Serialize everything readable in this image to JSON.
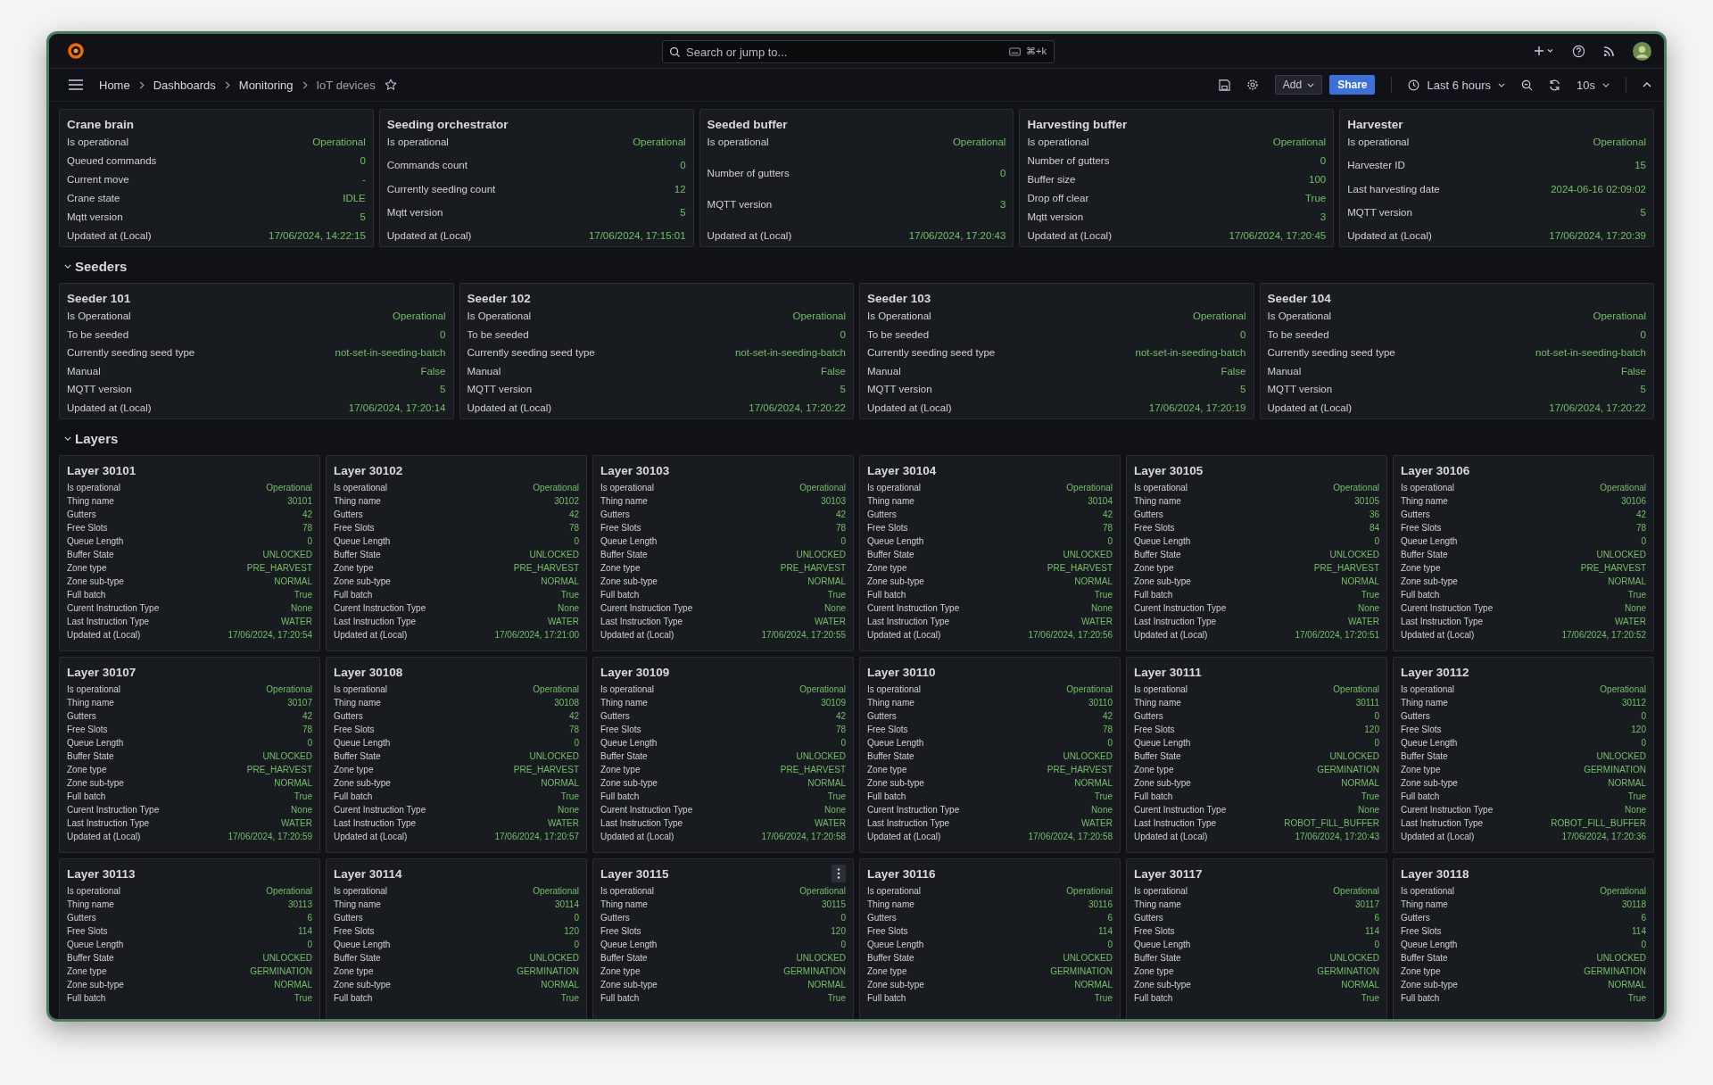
{
  "topbar": {
    "search_placeholder": "Search or jump to...",
    "search_shortcut": "⌘+k"
  },
  "breadcrumbs": [
    {
      "label": "Home"
    },
    {
      "label": "Dashboards"
    },
    {
      "label": "Monitoring"
    },
    {
      "label": "IoT devices"
    }
  ],
  "toolbar": {
    "add": "Add",
    "share": "Share",
    "time_range": "Last 6 hours",
    "refresh": "10s"
  },
  "sections": [
    {
      "panels": [
        {
          "title": "Crane brain",
          "rows": [
            {
              "label": "Is operational",
              "value": "Operational"
            },
            {
              "label": "Queued commands",
              "value": "0"
            },
            {
              "label": "Current move",
              "value": "-"
            },
            {
              "label": "Crane state",
              "value": "IDLE"
            },
            {
              "label": "Mqtt version",
              "value": "5"
            },
            {
              "label": "Updated at (Local)",
              "value": "17/06/2024, 14:22:15"
            }
          ]
        },
        {
          "title": "Seeding orchestrator",
          "rows": [
            {
              "label": "Is operational",
              "value": "Operational"
            },
            {
              "label": "Commands count",
              "value": "0"
            },
            {
              "label": "Currently seeding count",
              "value": "12"
            },
            {
              "label": "Mqtt version",
              "value": "5"
            },
            {
              "label": "Updated at (Local)",
              "value": "17/06/2024, 17:15:01"
            }
          ]
        },
        {
          "title": "Seeded buffer",
          "rows": [
            {
              "label": "Is operational",
              "value": "Operational"
            },
            {
              "label": "Number of gutters",
              "value": "0"
            },
            {
              "label": "MQTT version",
              "value": "3"
            },
            {
              "label": "Updated at (Local)",
              "value": "17/06/2024, 17:20:43"
            }
          ]
        },
        {
          "title": "Harvesting buffer",
          "rows": [
            {
              "label": "Is operational",
              "value": "Operational"
            },
            {
              "label": "Number of gutters",
              "value": "0"
            },
            {
              "label": "Buffer size",
              "value": "100"
            },
            {
              "label": "Drop off clear",
              "value": "True"
            },
            {
              "label": "Mqtt version",
              "value": "3"
            },
            {
              "label": "Updated at (Local)",
              "value": "17/06/2024, 17:20:45"
            }
          ]
        },
        {
          "title": "Harvester",
          "rows": [
            {
              "label": "Is operational",
              "value": "Operational"
            },
            {
              "label": "Harvester ID",
              "value": "15"
            },
            {
              "label": "Last harvesting date",
              "value": "2024-06-16 02:09:02"
            },
            {
              "label": "MQTT version",
              "value": "5"
            },
            {
              "label": "Updated at (Local)",
              "value": "17/06/2024, 17:20:39"
            }
          ]
        }
      ]
    },
    {
      "title": "Seeders",
      "expanded": true,
      "panels": [
        {
          "title": "Seeder 101",
          "rows": [
            {
              "label": "Is Operational",
              "value": "Operational"
            },
            {
              "label": "To be seeded",
              "value": "0"
            },
            {
              "label": "Currently seeding seed type",
              "value": "not-set-in-seeding-batch"
            },
            {
              "label": "Manual",
              "value": "False"
            },
            {
              "label": "MQTT version",
              "value": "5"
            },
            {
              "label": "Updated at (Local)",
              "value": "17/06/2024, 17:20:14"
            }
          ]
        },
        {
          "title": "Seeder 102",
          "rows": [
            {
              "label": "Is Operational",
              "value": "Operational"
            },
            {
              "label": "To be seeded",
              "value": "0"
            },
            {
              "label": "Currently seeding seed type",
              "value": "not-set-in-seeding-batch"
            },
            {
              "label": "Manual",
              "value": "False"
            },
            {
              "label": "MQTT version",
              "value": "5"
            },
            {
              "label": "Updated at (Local)",
              "value": "17/06/2024, 17:20:22"
            }
          ]
        },
        {
          "title": "Seeder 103",
          "rows": [
            {
              "label": "Is Operational",
              "value": "Operational"
            },
            {
              "label": "To be seeded",
              "value": "0"
            },
            {
              "label": "Currently seeding seed type",
              "value": "not-set-in-seeding-batch"
            },
            {
              "label": "Manual",
              "value": "False"
            },
            {
              "label": "MQTT version",
              "value": "5"
            },
            {
              "label": "Updated at (Local)",
              "value": "17/06/2024, 17:20:19"
            }
          ]
        },
        {
          "title": "Seeder 104",
          "rows": [
            {
              "label": "Is Operational",
              "value": "Operational"
            },
            {
              "label": "To be seeded",
              "value": "0"
            },
            {
              "label": "Currently seeding seed type",
              "value": "not-set-in-seeding-batch"
            },
            {
              "label": "Manual",
              "value": "False"
            },
            {
              "label": "MQTT version",
              "value": "5"
            },
            {
              "label": "Updated at (Local)",
              "value": "17/06/2024, 17:20:22"
            }
          ]
        }
      ]
    },
    {
      "title": "Layers",
      "expanded": true,
      "panels": [
        {
          "title": "Layer 30101",
          "rows": [
            {
              "label": "Is operational",
              "value": "Operational"
            },
            {
              "label": "Thing name",
              "value": "30101"
            },
            {
              "label": "Gutters",
              "value": "42"
            },
            {
              "label": "Free Slots",
              "value": "78"
            },
            {
              "label": "Queue Length",
              "value": "0"
            },
            {
              "label": "Buffer State",
              "value": "UNLOCKED"
            },
            {
              "label": "Zone type",
              "value": "PRE_HARVEST"
            },
            {
              "label": "Zone sub-type",
              "value": "NORMAL"
            },
            {
              "label": "Full batch",
              "value": "True"
            },
            {
              "label": "Curent Instruction Type",
              "value": "None"
            },
            {
              "label": "Last Instruction Type",
              "value": "WATER"
            },
            {
              "label": "Updated at (Local)",
              "value": "17/06/2024, 17:20:54"
            }
          ]
        },
        {
          "title": "Layer 30102",
          "rows": [
            {
              "label": "Is operational",
              "value": "Operational"
            },
            {
              "label": "Thing name",
              "value": "30102"
            },
            {
              "label": "Gutters",
              "value": "42"
            },
            {
              "label": "Free Slots",
              "value": "78"
            },
            {
              "label": "Queue Length",
              "value": "0"
            },
            {
              "label": "Buffer State",
              "value": "UNLOCKED"
            },
            {
              "label": "Zone type",
              "value": "PRE_HARVEST"
            },
            {
              "label": "Zone sub-type",
              "value": "NORMAL"
            },
            {
              "label": "Full batch",
              "value": "True"
            },
            {
              "label": "Curent Instruction Type",
              "value": "None"
            },
            {
              "label": "Last Instruction Type",
              "value": "WATER"
            },
            {
              "label": "Updated at (Local)",
              "value": "17/06/2024, 17:21:00"
            }
          ]
        },
        {
          "title": "Layer 30103",
          "rows": [
            {
              "label": "Is operational",
              "value": "Operational"
            },
            {
              "label": "Thing name",
              "value": "30103"
            },
            {
              "label": "Gutters",
              "value": "42"
            },
            {
              "label": "Free Slots",
              "value": "78"
            },
            {
              "label": "Queue Length",
              "value": "0"
            },
            {
              "label": "Buffer State",
              "value": "UNLOCKED"
            },
            {
              "label": "Zone type",
              "value": "PRE_HARVEST"
            },
            {
              "label": "Zone sub-type",
              "value": "NORMAL"
            },
            {
              "label": "Full batch",
              "value": "True"
            },
            {
              "label": "Curent Instruction Type",
              "value": "None"
            },
            {
              "label": "Last Instruction Type",
              "value": "WATER"
            },
            {
              "label": "Updated at (Local)",
              "value": "17/06/2024, 17:20:55"
            }
          ]
        },
        {
          "title": "Layer 30104",
          "rows": [
            {
              "label": "Is operational",
              "value": "Operational"
            },
            {
              "label": "Thing name",
              "value": "30104"
            },
            {
              "label": "Gutters",
              "value": "42"
            },
            {
              "label": "Free Slots",
              "value": "78"
            },
            {
              "label": "Queue Length",
              "value": "0"
            },
            {
              "label": "Buffer State",
              "value": "UNLOCKED"
            },
            {
              "label": "Zone type",
              "value": "PRE_HARVEST"
            },
            {
              "label": "Zone sub-type",
              "value": "NORMAL"
            },
            {
              "label": "Full batch",
              "value": "True"
            },
            {
              "label": "Curent Instruction Type",
              "value": "None"
            },
            {
              "label": "Last Instruction Type",
              "value": "WATER"
            },
            {
              "label": "Updated at (Local)",
              "value": "17/06/2024, 17:20:56"
            }
          ]
        },
        {
          "title": "Layer 30105",
          "rows": [
            {
              "label": "Is operational",
              "value": "Operational"
            },
            {
              "label": "Thing name",
              "value": "30105"
            },
            {
              "label": "Gutters",
              "value": "36"
            },
            {
              "label": "Free Slots",
              "value": "84"
            },
            {
              "label": "Queue Length",
              "value": "0"
            },
            {
              "label": "Buffer State",
              "value": "UNLOCKED"
            },
            {
              "label": "Zone type",
              "value": "PRE_HARVEST"
            },
            {
              "label": "Zone sub-type",
              "value": "NORMAL"
            },
            {
              "label": "Full batch",
              "value": "True"
            },
            {
              "label": "Curent Instruction Type",
              "value": "None"
            },
            {
              "label": "Last Instruction Type",
              "value": "WATER"
            },
            {
              "label": "Updated at (Local)",
              "value": "17/06/2024, 17:20:51"
            }
          ]
        },
        {
          "title": "Layer 30106",
          "rows": [
            {
              "label": "Is operational",
              "value": "Operational"
            },
            {
              "label": "Thing name",
              "value": "30106"
            },
            {
              "label": "Gutters",
              "value": "42"
            },
            {
              "label": "Free Slots",
              "value": "78"
            },
            {
              "label": "Queue Length",
              "value": "0"
            },
            {
              "label": "Buffer State",
              "value": "UNLOCKED"
            },
            {
              "label": "Zone type",
              "value": "PRE_HARVEST"
            },
            {
              "label": "Zone sub-type",
              "value": "NORMAL"
            },
            {
              "label": "Full batch",
              "value": "True"
            },
            {
              "label": "Curent Instruction Type",
              "value": "None"
            },
            {
              "label": "Last Instruction Type",
              "value": "WATER"
            },
            {
              "label": "Updated at (Local)",
              "value": "17/06/2024, 17:20:52"
            }
          ]
        },
        {
          "title": "Layer 30107",
          "rows": [
            {
              "label": "Is operational",
              "value": "Operational"
            },
            {
              "label": "Thing name",
              "value": "30107"
            },
            {
              "label": "Gutters",
              "value": "42"
            },
            {
              "label": "Free Slots",
              "value": "78"
            },
            {
              "label": "Queue Length",
              "value": "0"
            },
            {
              "label": "Buffer State",
              "value": "UNLOCKED"
            },
            {
              "label": "Zone type",
              "value": "PRE_HARVEST"
            },
            {
              "label": "Zone sub-type",
              "value": "NORMAL"
            },
            {
              "label": "Full batch",
              "value": "True"
            },
            {
              "label": "Curent Instruction Type",
              "value": "None"
            },
            {
              "label": "Last Instruction Type",
              "value": "WATER"
            },
            {
              "label": "Updated at (Local)",
              "value": "17/06/2024, 17:20:59"
            }
          ]
        },
        {
          "title": "Layer 30108",
          "rows": [
            {
              "label": "Is operational",
              "value": "Operational"
            },
            {
              "label": "Thing name",
              "value": "30108"
            },
            {
              "label": "Gutters",
              "value": "42"
            },
            {
              "label": "Free Slots",
              "value": "78"
            },
            {
              "label": "Queue Length",
              "value": "0"
            },
            {
              "label": "Buffer State",
              "value": "UNLOCKED"
            },
            {
              "label": "Zone type",
              "value": "PRE_HARVEST"
            },
            {
              "label": "Zone sub-type",
              "value": "NORMAL"
            },
            {
              "label": "Full batch",
              "value": "True"
            },
            {
              "label": "Curent Instruction Type",
              "value": "None"
            },
            {
              "label": "Last Instruction Type",
              "value": "WATER"
            },
            {
              "label": "Updated at (Local)",
              "value": "17/06/2024, 17:20:57"
            }
          ]
        },
        {
          "title": "Layer 30109",
          "rows": [
            {
              "label": "Is operational",
              "value": "Operational"
            },
            {
              "label": "Thing name",
              "value": "30109"
            },
            {
              "label": "Gutters",
              "value": "42"
            },
            {
              "label": "Free Slots",
              "value": "78"
            },
            {
              "label": "Queue Length",
              "value": "0"
            },
            {
              "label": "Buffer State",
              "value": "UNLOCKED"
            },
            {
              "label": "Zone type",
              "value": "PRE_HARVEST"
            },
            {
              "label": "Zone sub-type",
              "value": "NORMAL"
            },
            {
              "label": "Full batch",
              "value": "True"
            },
            {
              "label": "Curent Instruction Type",
              "value": "None"
            },
            {
              "label": "Last Instruction Type",
              "value": "WATER"
            },
            {
              "label": "Updated at (Local)",
              "value": "17/06/2024, 17:20:58"
            }
          ]
        },
        {
          "title": "Layer 30110",
          "rows": [
            {
              "label": "Is operational",
              "value": "Operational"
            },
            {
              "label": "Thing name",
              "value": "30110"
            },
            {
              "label": "Gutters",
              "value": "42"
            },
            {
              "label": "Free Slots",
              "value": "78"
            },
            {
              "label": "Queue Length",
              "value": "0"
            },
            {
              "label": "Buffer State",
              "value": "UNLOCKED"
            },
            {
              "label": "Zone type",
              "value": "PRE_HARVEST"
            },
            {
              "label": "Zone sub-type",
              "value": "NORMAL"
            },
            {
              "label": "Full batch",
              "value": "True"
            },
            {
              "label": "Curent Instruction Type",
              "value": "None"
            },
            {
              "label": "Last Instruction Type",
              "value": "WATER"
            },
            {
              "label": "Updated at (Local)",
              "value": "17/06/2024, 17:20:58"
            }
          ]
        },
        {
          "title": "Layer 30111",
          "rows": [
            {
              "label": "Is operational",
              "value": "Operational"
            },
            {
              "label": "Thing name",
              "value": "30111"
            },
            {
              "label": "Gutters",
              "value": "0"
            },
            {
              "label": "Free Slots",
              "value": "120"
            },
            {
              "label": "Queue Length",
              "value": "0"
            },
            {
              "label": "Buffer State",
              "value": "UNLOCKED"
            },
            {
              "label": "Zone type",
              "value": "GERMINATION"
            },
            {
              "label": "Zone sub-type",
              "value": "NORMAL"
            },
            {
              "label": "Full batch",
              "value": "True"
            },
            {
              "label": "Curent Instruction Type",
              "value": "None"
            },
            {
              "label": "Last Instruction Type",
              "value": "ROBOT_FILL_BUFFER"
            },
            {
              "label": "Updated at (Local)",
              "value": "17/06/2024, 17:20:43"
            }
          ]
        },
        {
          "title": "Layer 30112",
          "rows": [
            {
              "label": "Is operational",
              "value": "Operational"
            },
            {
              "label": "Thing name",
              "value": "30112"
            },
            {
              "label": "Gutters",
              "value": "0"
            },
            {
              "label": "Free Slots",
              "value": "120"
            },
            {
              "label": "Queue Length",
              "value": "0"
            },
            {
              "label": "Buffer State",
              "value": "UNLOCKED"
            },
            {
              "label": "Zone type",
              "value": "GERMINATION"
            },
            {
              "label": "Zone sub-type",
              "value": "NORMAL"
            },
            {
              "label": "Full batch",
              "value": "True"
            },
            {
              "label": "Curent Instruction Type",
              "value": "None"
            },
            {
              "label": "Last Instruction Type",
              "value": "ROBOT_FILL_BUFFER"
            },
            {
              "label": "Updated at (Local)",
              "value": "17/06/2024, 17:20:36"
            }
          ]
        },
        {
          "title": "Layer 30113",
          "rows": [
            {
              "label": "Is operational",
              "value": "Operational"
            },
            {
              "label": "Thing name",
              "value": "30113"
            },
            {
              "label": "Gutters",
              "value": "6"
            },
            {
              "label": "Free Slots",
              "value": "114"
            },
            {
              "label": "Queue Length",
              "value": "0"
            },
            {
              "label": "Buffer State",
              "value": "UNLOCKED"
            },
            {
              "label": "Zone type",
              "value": "GERMINATION"
            },
            {
              "label": "Zone sub-type",
              "value": "NORMAL"
            },
            {
              "label": "Full batch",
              "value": "True"
            }
          ]
        },
        {
          "title": "Layer 30114",
          "rows": [
            {
              "label": "Is operational",
              "value": "Operational"
            },
            {
              "label": "Thing name",
              "value": "30114"
            },
            {
              "label": "Gutters",
              "value": "0"
            },
            {
              "label": "Free Slots",
              "value": "120"
            },
            {
              "label": "Queue Length",
              "value": "0"
            },
            {
              "label": "Buffer State",
              "value": "UNLOCKED"
            },
            {
              "label": "Zone type",
              "value": "GERMINATION"
            },
            {
              "label": "Zone sub-type",
              "value": "NORMAL"
            },
            {
              "label": "Full batch",
              "value": "True"
            }
          ]
        },
        {
          "title": "Layer 30115",
          "menu_shown": true,
          "rows": [
            {
              "label": "Is operational",
              "value": "Operational"
            },
            {
              "label": "Thing name",
              "value": "30115"
            },
            {
              "label": "Gutters",
              "value": "0"
            },
            {
              "label": "Free Slots",
              "value": "120"
            },
            {
              "label": "Queue Length",
              "value": "0"
            },
            {
              "label": "Buffer State",
              "value": "UNLOCKED"
            },
            {
              "label": "Zone type",
              "value": "GERMINATION"
            },
            {
              "label": "Zone sub-type",
              "value": "NORMAL"
            },
            {
              "label": "Full batch",
              "value": "True"
            }
          ]
        },
        {
          "title": "Layer 30116",
          "rows": [
            {
              "label": "Is operational",
              "value": "Operational"
            },
            {
              "label": "Thing name",
              "value": "30116"
            },
            {
              "label": "Gutters",
              "value": "6"
            },
            {
              "label": "Free Slots",
              "value": "114"
            },
            {
              "label": "Queue Length",
              "value": "0"
            },
            {
              "label": "Buffer State",
              "value": "UNLOCKED"
            },
            {
              "label": "Zone type",
              "value": "GERMINATION"
            },
            {
              "label": "Zone sub-type",
              "value": "NORMAL"
            },
            {
              "label": "Full batch",
              "value": "True"
            }
          ]
        },
        {
          "title": "Layer 30117",
          "rows": [
            {
              "label": "Is operational",
              "value": "Operational"
            },
            {
              "label": "Thing name",
              "value": "30117"
            },
            {
              "label": "Gutters",
              "value": "6"
            },
            {
              "label": "Free Slots",
              "value": "114"
            },
            {
              "label": "Queue Length",
              "value": "0"
            },
            {
              "label": "Buffer State",
              "value": "UNLOCKED"
            },
            {
              "label": "Zone type",
              "value": "GERMINATION"
            },
            {
              "label": "Zone sub-type",
              "value": "NORMAL"
            },
            {
              "label": "Full batch",
              "value": "True"
            }
          ]
        },
        {
          "title": "Layer 30118",
          "rows": [
            {
              "label": "Is operational",
              "value": "Operational"
            },
            {
              "label": "Thing name",
              "value": "30118"
            },
            {
              "label": "Gutters",
              "value": "6"
            },
            {
              "label": "Free Slots",
              "value": "114"
            },
            {
              "label": "Queue Length",
              "value": "0"
            },
            {
              "label": "Buffer State",
              "value": "UNLOCKED"
            },
            {
              "label": "Zone type",
              "value": "GERMINATION"
            },
            {
              "label": "Zone sub-type",
              "value": "NORMAL"
            },
            {
              "label": "Full batch",
              "value": "True"
            }
          ]
        }
      ]
    }
  ]
}
